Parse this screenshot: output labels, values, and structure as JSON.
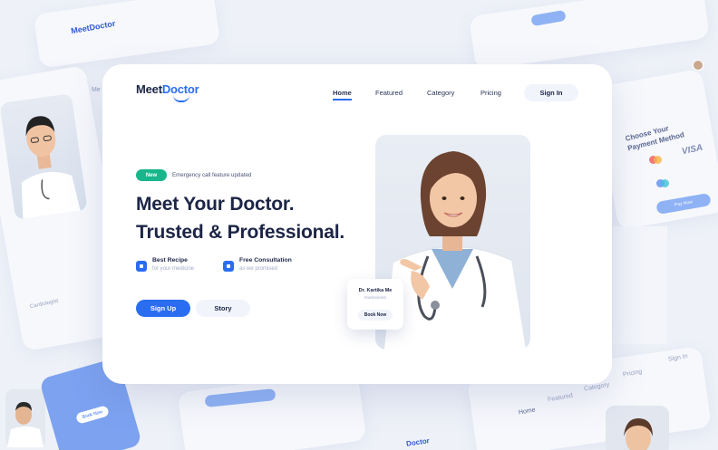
{
  "brand": {
    "meet": "Meet",
    "doctor": "Doctor"
  },
  "nav": {
    "items": [
      {
        "label": "Home",
        "active": true
      },
      {
        "label": "Featured",
        "active": false
      },
      {
        "label": "Category",
        "active": false
      },
      {
        "label": "Pricing",
        "active": false
      }
    ],
    "signin_label": "Sign In"
  },
  "hero": {
    "badge": "New",
    "badge_text": "Emergency call feature updated",
    "headline_1": "Meet Your Doctor.",
    "headline_2": "Trusted & Professional.",
    "features": [
      {
        "title": "Best Recipe",
        "subtitle": "for your medicine"
      },
      {
        "title": "Free Consultation",
        "subtitle": "as we promised"
      }
    ],
    "signup_label": "Sign Up",
    "story_label": "Story"
  },
  "doctor_card": {
    "name": "Dr. Kartika Me",
    "role": "Nutrisionist",
    "button": "Book Now"
  },
  "background": {
    "payment_title": "Choose Your Payment Method",
    "visa": "VISA",
    "pay_now": "Pay Now",
    "cardiologist": "Cardiologist",
    "book_now": "Book Now",
    "nav_home": "Home",
    "nav_featured": "Featured",
    "nav_category": "Category",
    "nav_pricing": "Pricing",
    "nav_signin": "Sign In",
    "logo_fragment": "Doctor",
    "logo_fragment2": "MeetDoctor",
    "me_fragment": "Me"
  },
  "colors": {
    "accent": "#2a6df0",
    "badge_green": "#19b58b",
    "text_dark": "#1c2546"
  }
}
